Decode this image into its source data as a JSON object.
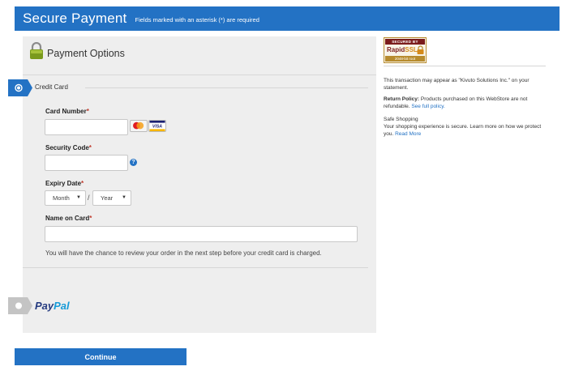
{
  "header": {
    "title": "Secure Payment",
    "note": "Fields marked with an asterisk (*) are required"
  },
  "panel": {
    "title": "Payment Options"
  },
  "credit_card": {
    "label": "Credit Card",
    "card_number_label": "Card Number",
    "security_code_label": "Security Code",
    "expiry_label": "Expiry Date",
    "month_selected": "Month",
    "year_selected": "Year",
    "expiry_separator": "/",
    "name_label": "Name on Card",
    "required_mark": "*",
    "help_glyph": "?",
    "card_number_value": "",
    "security_code_value": "",
    "name_value": "",
    "note": "You will have the chance to review your order in the next step before your credit card is charged."
  },
  "paypal": {
    "logo_a": "Pay",
    "logo_b": "Pal"
  },
  "continue_label": "Continue",
  "ssl_badge": {
    "top": "SECURED BY",
    "brand_a": "Rapid",
    "brand_b": "SSL",
    "bottom": "2048-bit root"
  },
  "sidebar": {
    "statement": "This transaction may appear as \"Kivuto Solutions Inc.\" on your statement.",
    "return_policy_label": "Return Policy:",
    "return_policy_text": "Products purchased on this WebStore are not refundable.",
    "return_policy_link": "See full policy.",
    "safe_title": "Safe Shopping",
    "safe_text": "Your shopping experience is secure. Learn more on how we protect you.",
    "safe_link": "Read More"
  },
  "colors": {
    "primary": "#2372c4",
    "panel_bg": "#eeeeee",
    "tab_active": "#2372c4",
    "tab_inactive": "#c4c4c4"
  },
  "icons": {
    "lock": "padlock-icon",
    "help": "question-icon",
    "mastercard": "mastercard-icon",
    "visa": "visa-icon",
    "radio": "radio-icon"
  }
}
